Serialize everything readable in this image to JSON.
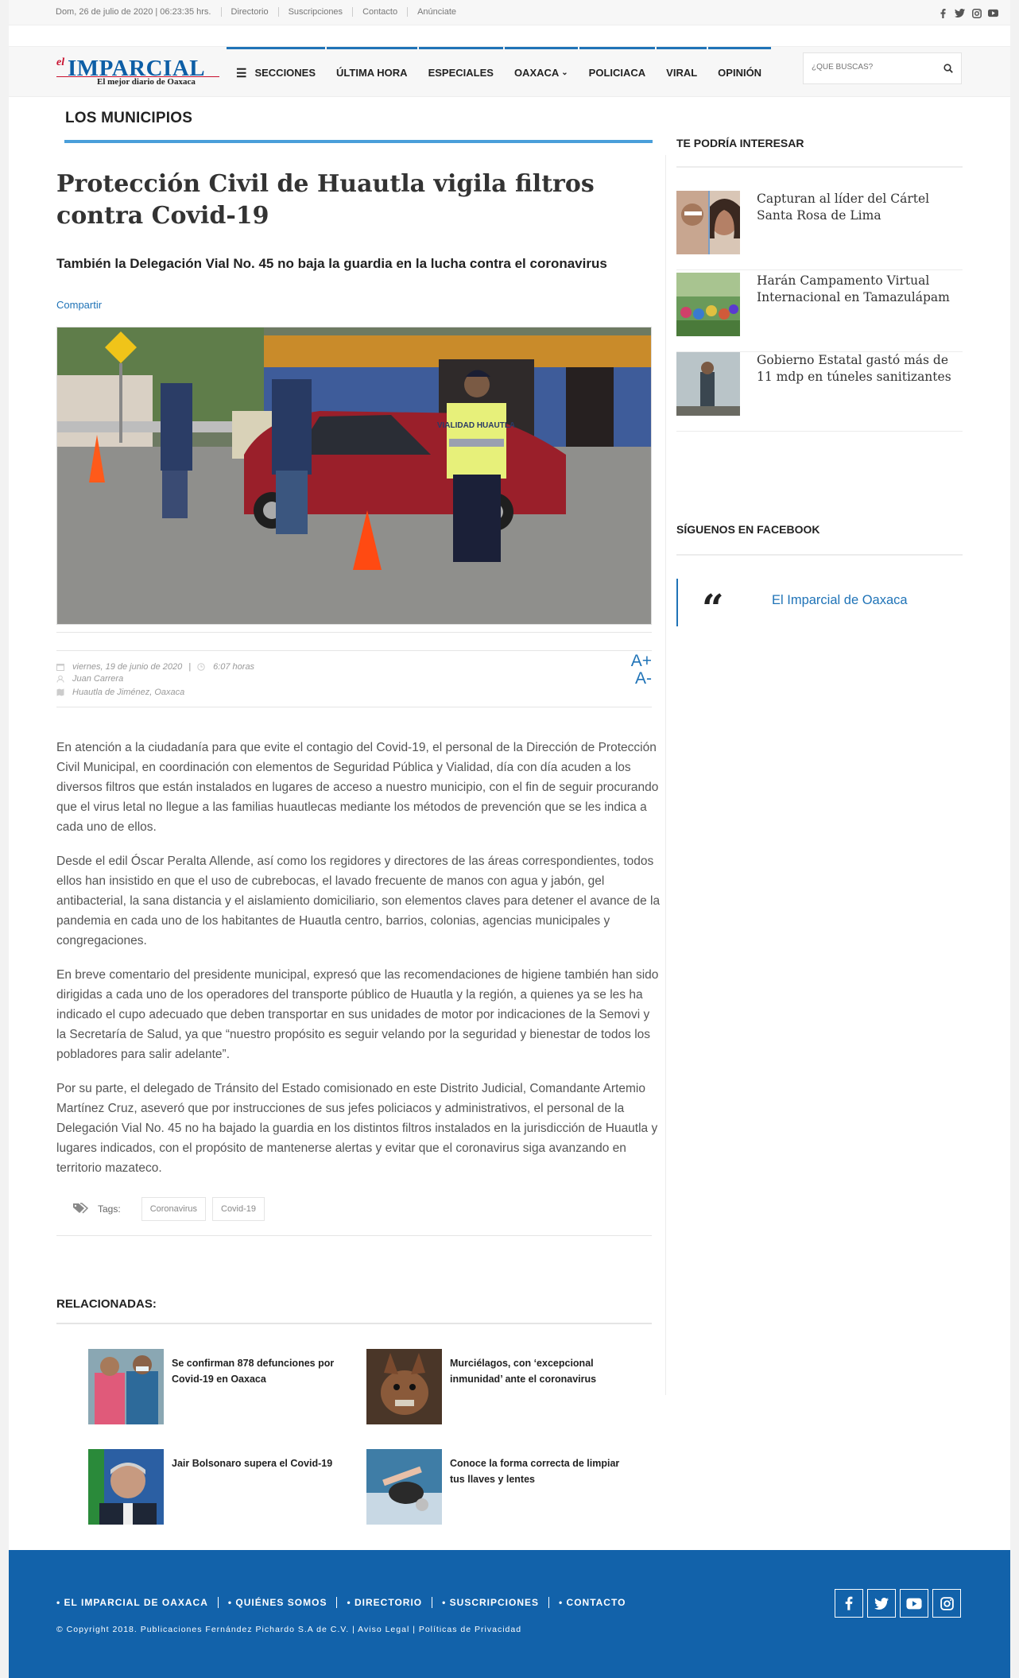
{
  "topbar": {
    "date": "Dom, 26 de julio de 2020 | 06:23:35 hrs.",
    "links": [
      "Directorio",
      "Suscripciones",
      "Contacto",
      "Anúnciate"
    ]
  },
  "header": {
    "logo_el": "el",
    "logo_name": "IMPARCIAL",
    "logo_tag": "El mejor diario de Oaxaca",
    "nav": [
      "SECCIONES",
      "ÚLTIMA HORA",
      "ESPECIALES",
      "OAXACA",
      "POLICIACA",
      "VIRAL",
      "OPINIÓN"
    ],
    "search_placeholder": "¿QUÉ BUSCAS?"
  },
  "section": {
    "title": "LOS MUNICIPIOS"
  },
  "article": {
    "title": "Protección Civil de Huautla vigila filtros contra Covid-19",
    "subtitle": "También la Delegación Vial No. 45 no baja la guardia en la lucha contra el coronavirus",
    "share": "Compartir",
    "photo_vest_text": "VIALIDAD HUAUTLA",
    "date": "viernes, 19 de junio de 2020",
    "time": "6:07 horas",
    "author": "Juan Carrera",
    "location": "Huautla de Jiménez, Oaxaca",
    "font_up": "A+",
    "font_down": "A-",
    "paragraphs": [
      "En atención a la ciudadanía para que evite el contagio del Covid-19, el personal de la Dirección de Protección Civil Municipal, en coordinación con elementos de Seguridad Pública y Vialidad, día con día acuden a los diversos filtros que están instalados en lugares de acceso a nuestro municipio, con el fin de seguir procurando que el virus letal no llegue a las familias huautlecas mediante los métodos de prevención que se les indica a cada uno de ellos.",
      "Desde el edil Óscar Peralta Allende, así como los regidores y directores de las áreas correspondientes, todos ellos han insistido en que el uso de cubrebocas, el lavado frecuente de manos con agua y jabón, gel antibacterial, la sana distancia y el aislamiento domiciliario, son elementos claves para detener el avance de la pandemia en cada uno de los habitantes de Huautla centro, barrios, colonias, agencias municipales y congregaciones.",
      "En breve comentario del presidente municipal, expresó que las recomendaciones de higiene también han sido dirigidas a cada uno de los operadores del transporte público de Huautla y la región, a quienes ya se les ha indicado el cupo adecuado que deben transportar en sus unidades de motor por indicaciones de la Semovi y la Secretaría de Salud, ya que “nuestro propósito es seguir velando por la seguridad y bienestar de todos los pobladores para salir adelante”.",
      "Por su parte, el delegado de Tránsito del Estado comisionado en este Distrito Judicial, Comandante Artemio Martínez Cruz, aseveró que por instrucciones de sus jefes policiacos y administrativos, el personal de la Delegación Vial No. 45 no ha bajado la guardia en los distintos filtros instalados en la jurisdicción de Huautla y lugares indicados, con el propósito de mantenerse alertas y evitar que el coronavirus siga avanzando en territorio mazateco."
    ],
    "tags_label": "Tags:",
    "tags": [
      "Coronavirus",
      "Covid-19"
    ]
  },
  "related": {
    "title": "RELACIONADAS:",
    "items": [
      "Se confirman 878 defunciones por Covid-19 en Oaxaca",
      "Murciélagos, con ‘excepcional inmunidad’ ante el coronavirus",
      "Jair Bolsonaro supera el Covid-19",
      "Conoce la forma correcta de limpiar tus llaves y lentes"
    ]
  },
  "sidebar": {
    "interest_title": "TE PODRÍA INTERESAR",
    "interest": [
      "Capturan al líder del Cártel Santa Rosa de Lima",
      "Harán Campamento Virtual Internacional en Tamazulápam",
      "Gobierno Estatal gastó más de 11 mdp en túneles sanitizantes"
    ],
    "facebook_title": "SÍGUENOS EN FACEBOOK",
    "facebook_link": "El Imparcial de Oaxaca"
  },
  "footer": {
    "links": [
      "• EL IMPARCIAL DE OAXACA",
      "• QUIÉNES SOMOS",
      "• DIRECTORIO",
      "• SUSCRIPCIONES",
      "• CONTACTO"
    ],
    "copyright": "© Copyright 2018. Publicaciones Fernández Pichardo S.A de C.V. | Aviso Legal | Políticas de Privacidad"
  },
  "colors": {
    "accent": "#1f73b7",
    "footer": "#1262aa",
    "section_rule": "#4a9fda",
    "brand_red": "#c8102e"
  }
}
